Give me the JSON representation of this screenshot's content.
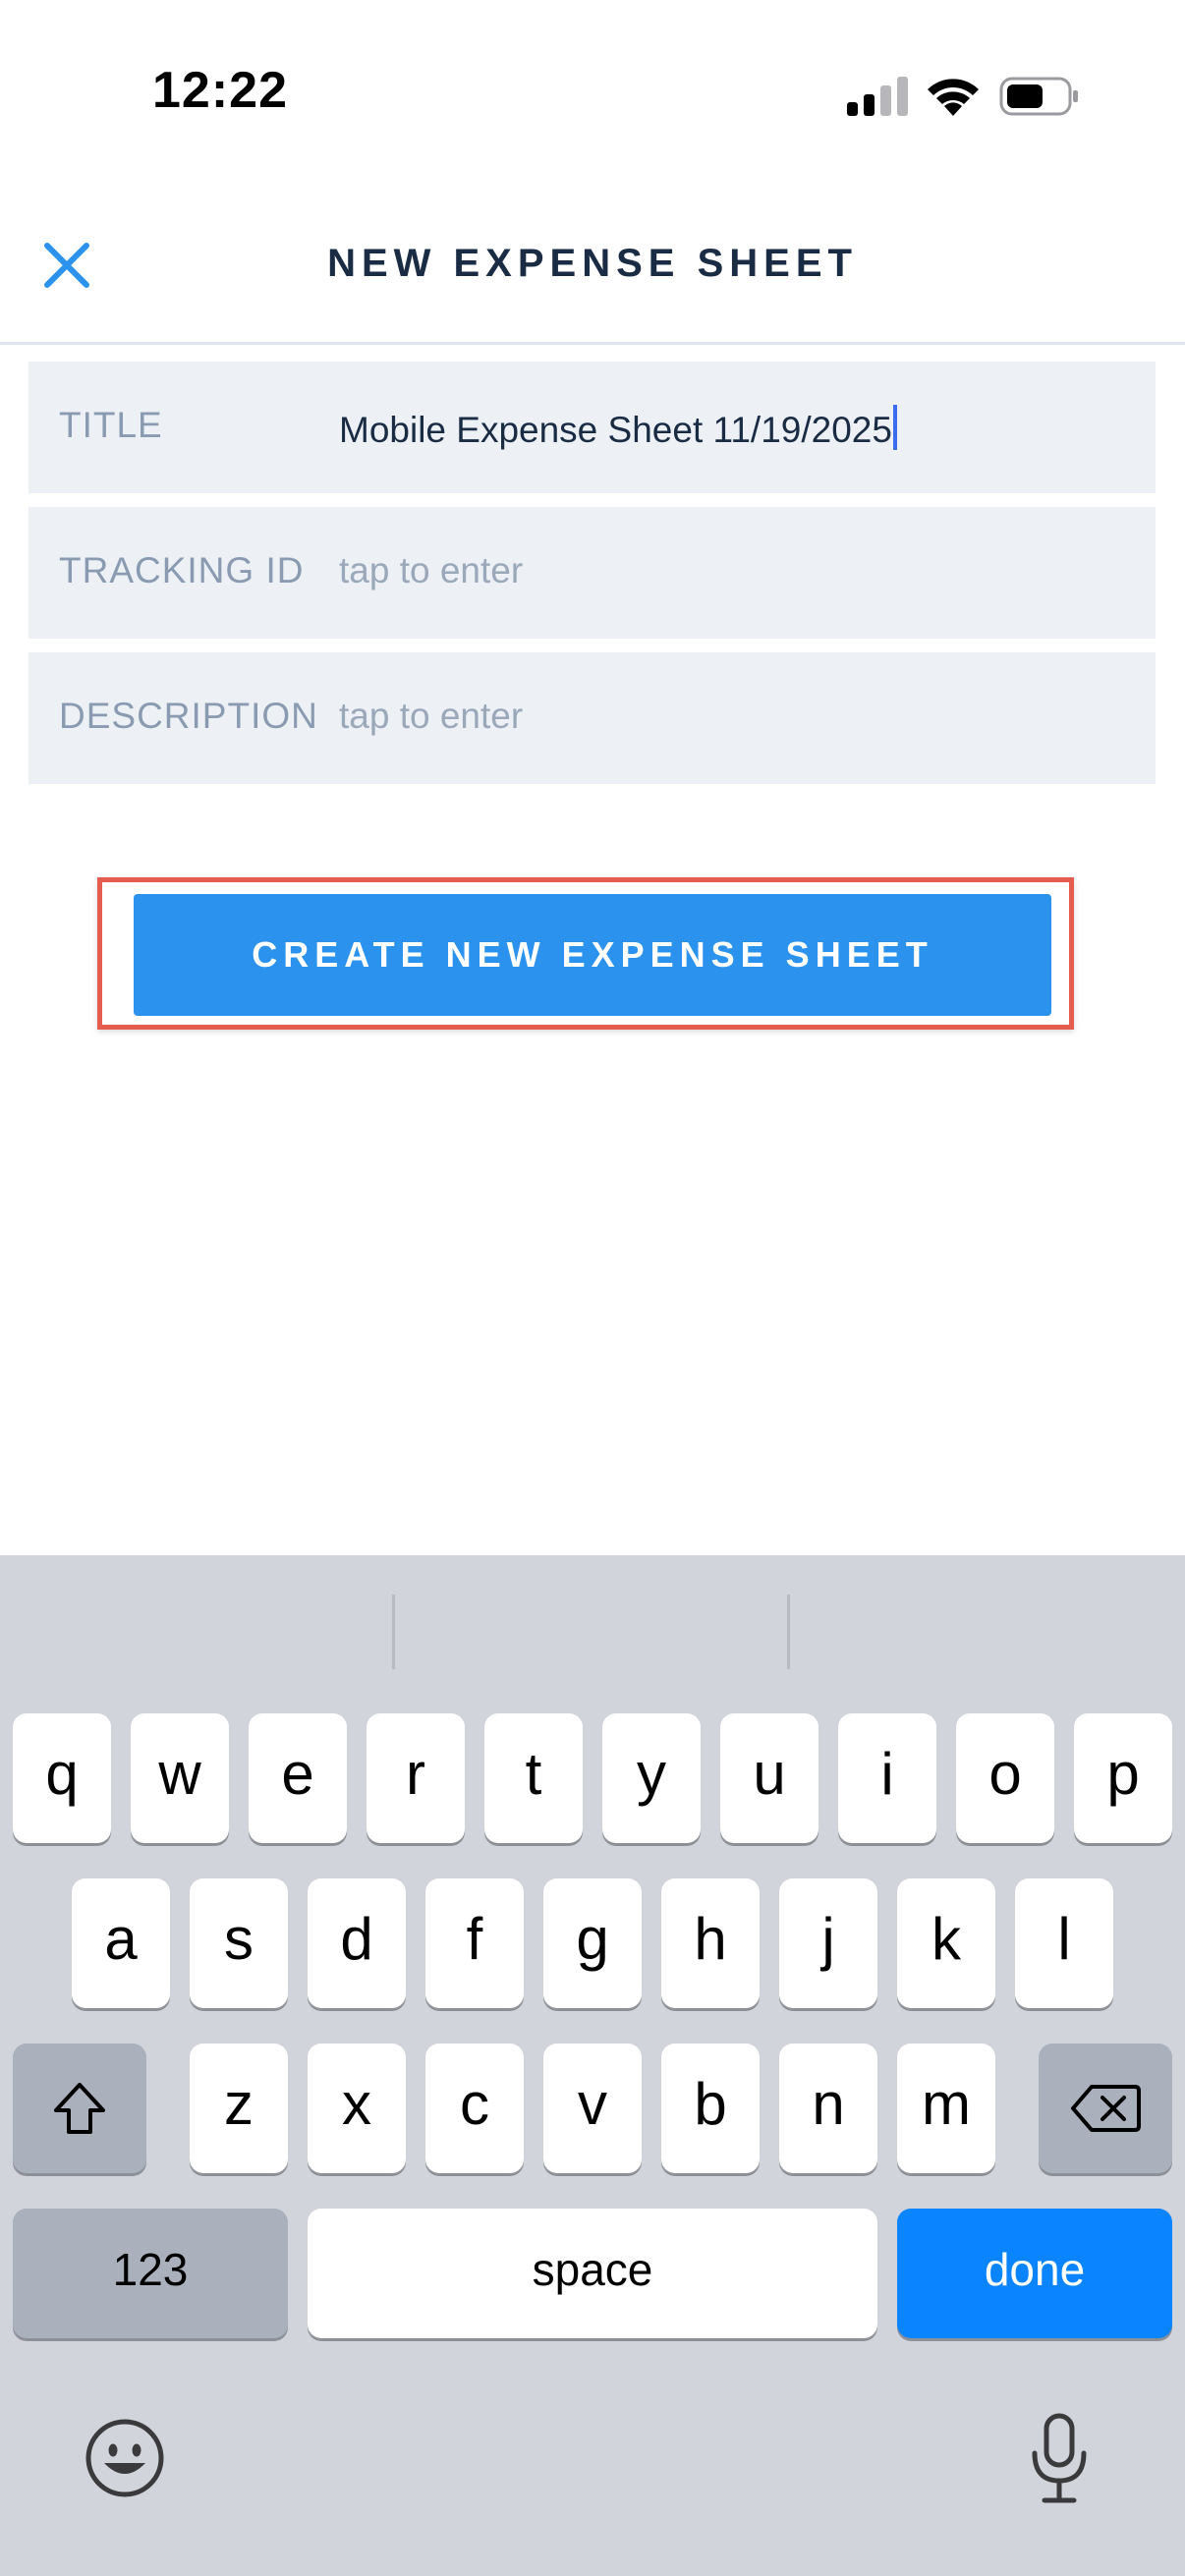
{
  "status_bar": {
    "time": "12:22"
  },
  "header": {
    "title": "NEW EXPENSE SHEET"
  },
  "form": {
    "title_label": "TITLE",
    "title_value": "Mobile Expense Sheet 11/19/2025",
    "tracking_label": "TRACKING ID",
    "tracking_placeholder": "tap to enter",
    "description_label": "DESCRIPTION",
    "description_placeholder": "tap to enter"
  },
  "create_button": {
    "label": "CREATE NEW EXPENSE SHEET"
  },
  "keyboard": {
    "row1": [
      "q",
      "w",
      "e",
      "r",
      "t",
      "y",
      "u",
      "i",
      "o",
      "p"
    ],
    "row2": [
      "a",
      "s",
      "d",
      "f",
      "g",
      "h",
      "j",
      "k",
      "l"
    ],
    "row3": [
      "z",
      "x",
      "c",
      "v",
      "b",
      "n",
      "m"
    ],
    "numbers_label": "123",
    "space_label": "space",
    "done_label": "done",
    "icons": [
      "shift-icon",
      "backspace-icon",
      "emoji-icon",
      "microphone-icon"
    ]
  },
  "colors": {
    "accent": "#2b93ee",
    "highlight_border": "#e65c4f",
    "field_background": "#edf1f6",
    "title_text": "#1a2b44",
    "keyboard_background": "#d1d4db",
    "done_key": "#0a84ff"
  }
}
